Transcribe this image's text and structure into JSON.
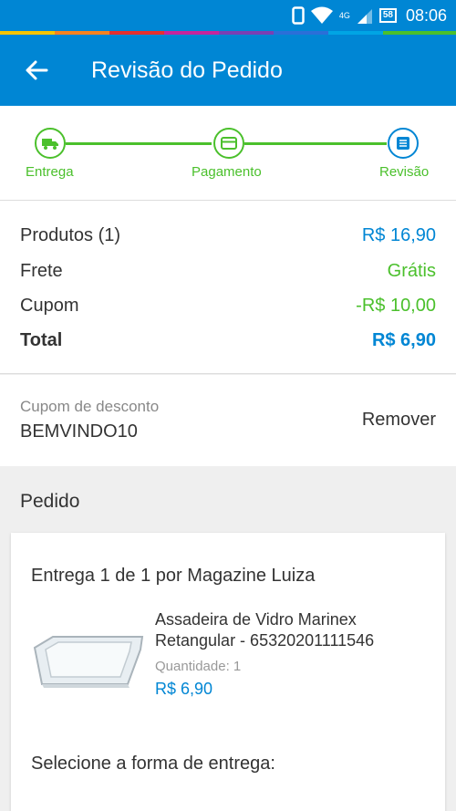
{
  "status_bar": {
    "network": "4G",
    "battery": "58",
    "time": "08:06"
  },
  "header": {
    "title": "Revisão do Pedido",
    "back_icon": "arrow-left-icon"
  },
  "steps": [
    {
      "label": "Entrega",
      "icon": "truck-icon",
      "state": "done"
    },
    {
      "label": "Pagamento",
      "icon": "card-icon",
      "state": "done"
    },
    {
      "label": "Revisão",
      "icon": "list-icon",
      "state": "current"
    }
  ],
  "summary": {
    "products_label": "Produtos (1)",
    "products_value": "R$ 16,90",
    "shipping_label": "Frete",
    "shipping_value": "Grátis",
    "coupon_label": "Cupom",
    "coupon_value": "-R$ 10,00",
    "total_label": "Total",
    "total_value": "R$ 6,90"
  },
  "coupon": {
    "label": "Cupom de desconto",
    "code": "BEMVINDO10",
    "remove_label": "Remover"
  },
  "order": {
    "section_title": "Pedido",
    "seller_line": "Entrega 1 de 1 por Magazine Luiza",
    "product_name": "Assadeira de Vidro Marinex Retangular - 65320201111546",
    "quantity_label": "Quantidade:",
    "quantity": "1",
    "price": "R$ 6,90",
    "shipping_prompt": "Selecione a forma de entrega:"
  },
  "colors": {
    "primary": "#0086d4",
    "success": "#4bc02c"
  }
}
